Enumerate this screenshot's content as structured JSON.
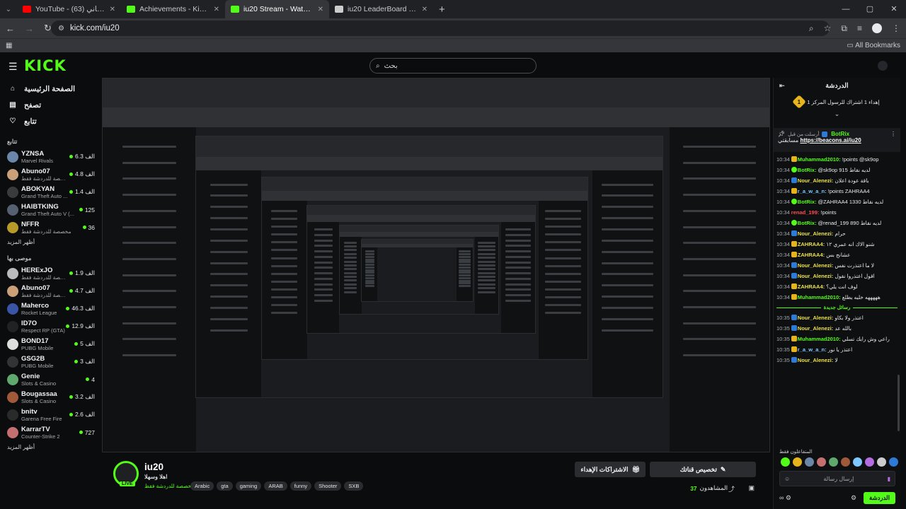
{
  "browser": {
    "tabs": [
      {
        "title": "YouTube - بالعين غساني (63)",
        "color": "#ff0000",
        "active": false
      },
      {
        "title": "Achievements - Kick Dashboard",
        "color": "#53fc18",
        "active": false
      },
      {
        "title": "iu20 Stream - Watch Live on Kick",
        "color": "#53fc18",
        "active": true
      },
      {
        "title": "iu20 LeaderBoard | The best Ch",
        "color": "#cccccc",
        "active": false
      }
    ],
    "url": "kick.com/iu20",
    "bookmarks_label": "All Bookmarks"
  },
  "header": {
    "logo": "KICK",
    "search_placeholder": "بحث"
  },
  "sidebar": {
    "nav": [
      {
        "label": "الصفحة الرئيسية",
        "icon": "home-icon",
        "glyph": "⌂"
      },
      {
        "label": "تصفح",
        "icon": "browse-icon",
        "glyph": "▤"
      },
      {
        "label": "تتابع",
        "icon": "heart-icon",
        "glyph": "♡"
      }
    ],
    "following_title": "تتابع",
    "following": [
      {
        "name": "YZNSA",
        "category": "Marvel Rivals",
        "viewers": "6.3 الف",
        "color": "#6a86a8"
      },
      {
        "name": "Abuno07",
        "category": "مخصصة للدردشة فقط",
        "viewers": "4.8 الف",
        "color": "#c9a07a"
      },
      {
        "name": "ABOKYAN",
        "category": "Grand Theft Auto ...",
        "viewers": "1.4 الف",
        "color": "#3b3b3b"
      },
      {
        "name": "HAIBTKING",
        "category": "Grand Theft Auto V (...",
        "viewers": "125",
        "color": "#556070"
      },
      {
        "name": "NFFR",
        "category": "مخصصة للدردشة فقط",
        "viewers": "36",
        "color": "#b89a2a"
      }
    ],
    "show_more_1": "أظهر المزيد",
    "recommended_title": "موصى بها",
    "recommended": [
      {
        "name": "HERExJO",
        "category": "مخصصة للدردشة فقط",
        "viewers": "1.9 الف",
        "color": "#bbbbbb"
      },
      {
        "name": "Abuno07",
        "category": "مخصصة للدردشة فقط",
        "viewers": "4.7 الف",
        "color": "#c9a07a"
      },
      {
        "name": "Maherco",
        "category": "Rocket League",
        "viewers": "46.3 الف",
        "color": "#3a55a5"
      },
      {
        "name": "ID7O",
        "category": "Respect RP (GTA)",
        "viewers": "12.9 الف",
        "color": "#222222"
      },
      {
        "name": "BOND17",
        "category": "PUBG Mobile",
        "viewers": "5 الف",
        "color": "#dddddd"
      },
      {
        "name": "GSG2B",
        "category": "PUBG Mobile",
        "viewers": "3 الف",
        "color": "#333333"
      },
      {
        "name": "Genie",
        "category": "Slots & Casino",
        "viewers": "4",
        "color": "#5fa86e"
      },
      {
        "name": "Bougassaa",
        "category": "Slots & Casino",
        "viewers": "3.2 الف",
        "color": "#a05a3a"
      },
      {
        "name": "bnitv",
        "category": "Garena Free Fire",
        "viewers": "2.6 الف",
        "color": "#2a2a2a"
      },
      {
        "name": "KarrarTV",
        "category": "Counter-Strike 2",
        "viewers": "727",
        "color": "#c47070"
      }
    ],
    "show_more_2": "أظهر المزيد"
  },
  "stream": {
    "name": "iu20",
    "live": "LIVE",
    "title": "اهلا وسهلا",
    "category": "مخصصة للدردشة فقط",
    "tags": [
      "Arabic",
      "gta",
      "gaming",
      "ARAB",
      "funny",
      "Shooter",
      "SXB"
    ],
    "subscribe_label": "تخصيص قناتك",
    "gift_label": "الاشتراكات الإهداء",
    "viewers_label": "المشاهدون",
    "viewers_count": "37"
  },
  "chat": {
    "title": "الدردشة",
    "top_gifter": "إهداء 1 اشتراك للرسول المركز 1",
    "top_gifter_rank": "1",
    "pinned_by": "أرسلت من قبل",
    "pinned_user": "BotRix",
    "pinned_text": "مسابقتي",
    "pinned_link": "https://beacons.ai/iu20",
    "messages": [
      {
        "ts": "10:34",
        "badge": "gold",
        "user": "Muhammad2010:",
        "ucls": "u-green",
        "text": "!points @sk9op"
      },
      {
        "ts": "10:34",
        "badge": "green",
        "user": "BotRix:",
        "ucls": "u-green",
        "text": "@sk9op لديه نقاط 915"
      },
      {
        "ts": "10:34",
        "badge": "blue",
        "user": "Nour_Alenezi:",
        "ucls": "u-yellow",
        "text": "باقة عودة اعلان"
      },
      {
        "ts": "10:34",
        "badge": "gold",
        "user": "r_a_w_a_n:",
        "ucls": "u-blue",
        "text": "!points ZAHRAA4"
      },
      {
        "ts": "10:34",
        "badge": "green",
        "user": "BotRix:",
        "ucls": "u-green",
        "text": "@ZAHRAA4 لديه نقاط 1330"
      },
      {
        "ts": "10:34",
        "badge": "",
        "user": "renad_199:",
        "ucls": "u-red",
        "text": "!points"
      },
      {
        "ts": "10:34",
        "badge": "green",
        "user": "BotRix:",
        "ucls": "u-green",
        "text": "@renad_199 لديه نقاط 890"
      },
      {
        "ts": "10:34",
        "badge": "blue",
        "user": "Nour_Alenezi:",
        "ucls": "u-yellow",
        "text": "حرام"
      },
      {
        "ts": "10:34",
        "badge": "gold",
        "user": "ZAHRAA4:",
        "ucls": "u-yellow",
        "text": "شنو الاك انه عمري ١٢"
      },
      {
        "ts": "10:34",
        "badge": "gold",
        "user": "ZAHRAA4:",
        "ucls": "u-yellow",
        "text": "عشانج بس"
      },
      {
        "ts": "10:34",
        "badge": "blue",
        "user": "Nour_Alenezi:",
        "ucls": "u-yellow",
        "text": "لا ما اعتذرت نفس"
      },
      {
        "ts": "10:34",
        "badge": "blue",
        "user": "Nour_Alenezi:",
        "ucls": "u-yellow",
        "text": "اقول اعتذروا نقول"
      },
      {
        "ts": "10:34",
        "badge": "gold",
        "user": "ZAHRAA4:",
        "ucls": "u-yellow",
        "text": "لوف انت يلي؟"
      },
      {
        "ts": "10:34",
        "badge": "gold",
        "user": "Muhammad2010:",
        "ucls": "u-green",
        "text": "هههههه خليه يطلع"
      }
    ],
    "new_messages": "رسائل جديدة",
    "messages_after": [
      {
        "ts": "10:35",
        "badge": "blue",
        "user": "Nour_Alenezi:",
        "ucls": "u-yellow",
        "text": "اعتذر ولا بكاو"
      },
      {
        "ts": "10:35",
        "badge": "blue",
        "user": "Nour_Alenezi:",
        "ucls": "u-yellow",
        "text": "بالله عد"
      },
      {
        "ts": "10:35",
        "badge": "gold",
        "user": "Muhammad2010:",
        "ucls": "u-green",
        "text": "راعي وش رايك تسلي"
      },
      {
        "ts": "10:35",
        "badge": "gold",
        "user": "r_a_w_a_n:",
        "ucls": "u-blue",
        "text": "اعتذر يا نور"
      },
      {
        "ts": "10:35",
        "badge": "blue",
        "user": "Nour_Alenezi:",
        "ucls": "u-yellow",
        "text": "لا"
      }
    ],
    "chatters_label": "المتفاعلون فقط",
    "input_placeholder": "إرسال رسالة",
    "send_label": "الدردشة"
  }
}
